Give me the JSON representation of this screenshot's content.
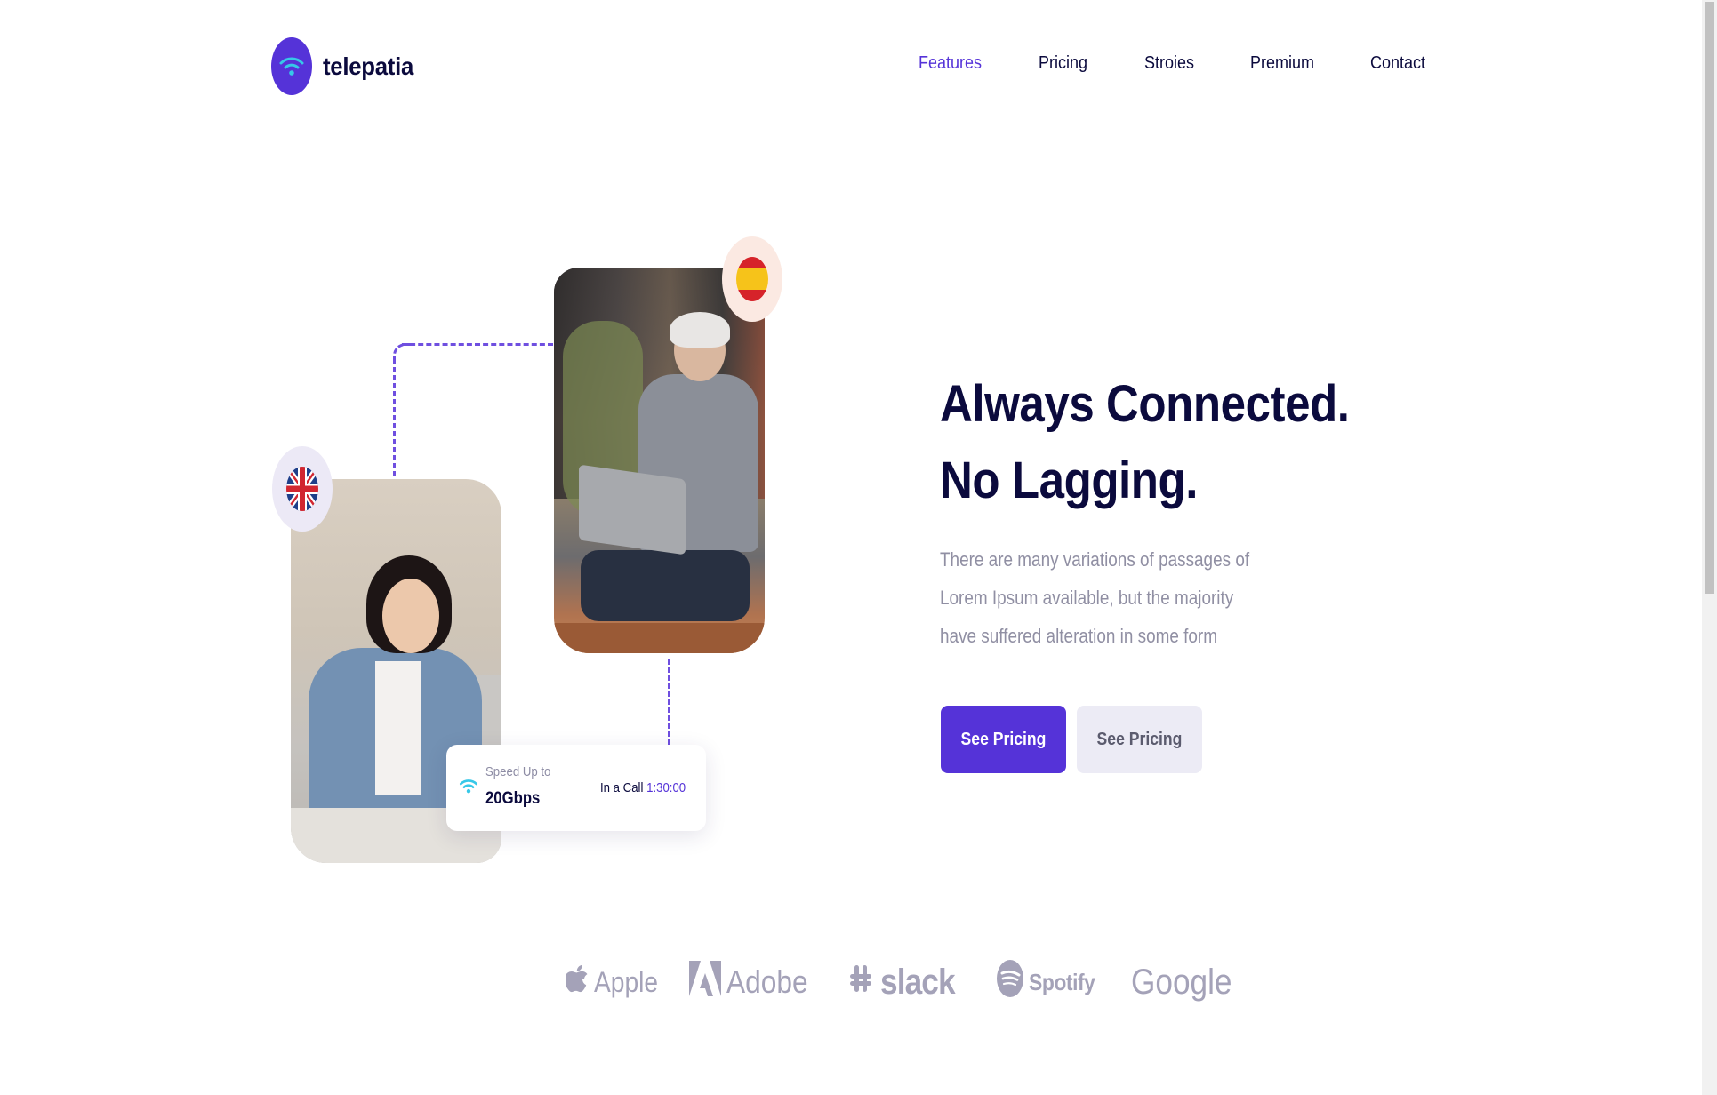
{
  "brand": {
    "name": "telepatia",
    "logo_icon": "wifi-icon",
    "accent_color": "#5533d8",
    "dark_text_color": "#0b0a3d"
  },
  "nav": {
    "items": [
      {
        "label": "Features",
        "active": true
      },
      {
        "label": "Pricing",
        "active": false
      },
      {
        "label": "Stroies",
        "active": false
      },
      {
        "label": "Premium",
        "active": false
      },
      {
        "label": "Contact",
        "active": false
      }
    ]
  },
  "hero": {
    "title_line1": "Always Connected.",
    "title_line2": "No Lagging.",
    "description": "There are many variations of passages of Lorem Ipsum available, but the majority have suffered alteration in some form",
    "primary_button": "See Pricing",
    "secondary_button": "See Pricing"
  },
  "visual": {
    "flag_top": "spain-flag-icon",
    "flag_left": "uk-flag-icon",
    "speed_card": {
      "label": "Speed Up to",
      "value": "20Gbps",
      "call_label": "In a Call",
      "call_time": "1:30:00"
    }
  },
  "brands": [
    {
      "name": "Apple",
      "icon": "apple-icon"
    },
    {
      "name": "Adobe",
      "icon": "adobe-icon"
    },
    {
      "name": "slack",
      "icon": "slack-icon"
    },
    {
      "name": "Spotify",
      "icon": "spotify-icon"
    },
    {
      "name": "Google",
      "icon": ""
    }
  ]
}
